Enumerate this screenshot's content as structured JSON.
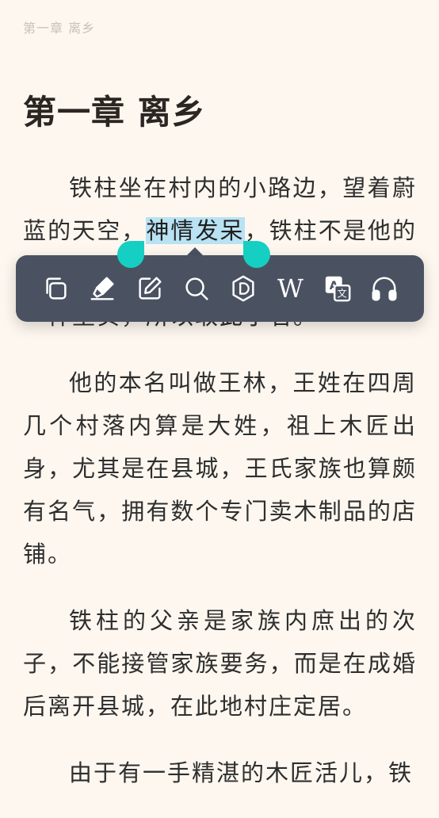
{
  "header": {
    "running_title": "第一章 离乡"
  },
  "chapter": {
    "title": "第一章 离乡"
  },
  "paragraphs": {
    "p1_before": "铁柱坐在村内的小路边，望着蔚蓝的天空，",
    "p1_selected": "神情发呆",
    "p1_after": "，铁柱不是他的本名，因为他家里人希望他能像铁柱一样坚实，所以取此小名。",
    "p2": "他的本名叫做王林，王姓在四周几个村落内算是大姓，祖上木匠出身，尤其是在县城，王氏家族也算颇有名气，拥有数个专门卖木制品的店铺。",
    "p3": "铁柱的父亲是家族内庶出的次子，不能接管家族要务，而是在成婚后离开县城，在此地村庄定居。",
    "p4": "由于有一手精湛的木匠活儿，铁"
  },
  "toolbar": {
    "items": [
      {
        "name": "copy",
        "icon": "copy-icon"
      },
      {
        "name": "highlight",
        "icon": "highlighter-icon"
      },
      {
        "name": "note",
        "icon": "edit-note-icon"
      },
      {
        "name": "search",
        "icon": "search-icon"
      },
      {
        "name": "dictionary",
        "icon": "dictionary-icon"
      },
      {
        "name": "wikipedia",
        "icon": "wikipedia-icon",
        "glyph": "W"
      },
      {
        "name": "translate",
        "icon": "translate-icon",
        "glyph_a": "A",
        "glyph_zh": "文"
      },
      {
        "name": "read-aloud",
        "icon": "headphones-icon"
      }
    ]
  },
  "colors": {
    "background": "#fdf7ef",
    "text": "#2e2e2e",
    "selection": "#b9e2f3",
    "handle": "#15cfc2",
    "toolbar": "#4a5261"
  }
}
